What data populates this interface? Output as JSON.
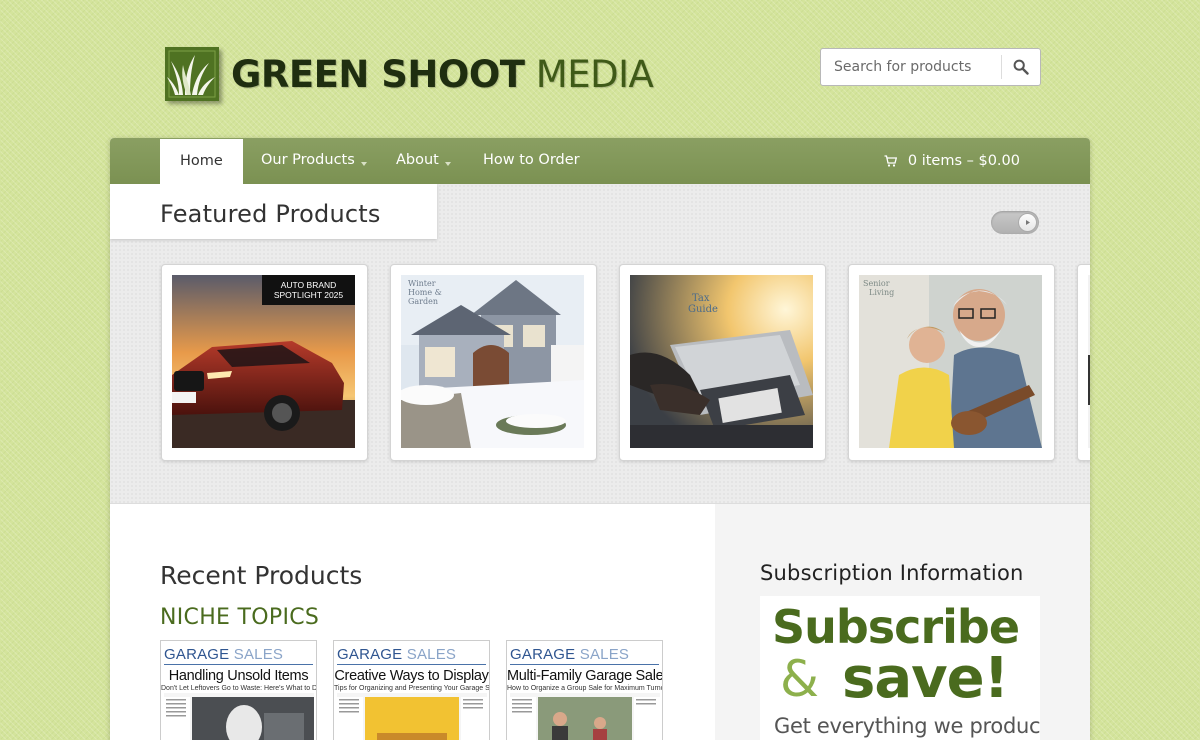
{
  "brand": {
    "name_bold": "GREEN SHOOT",
    "name_light": "MEDIA"
  },
  "search": {
    "placeholder": "Search for products"
  },
  "nav": {
    "items": [
      {
        "label": "Home",
        "active": true,
        "has_dropdown": false
      },
      {
        "label": "Our Products",
        "active": false,
        "has_dropdown": true
      },
      {
        "label": "About",
        "active": false,
        "has_dropdown": true
      },
      {
        "label": "How to Order",
        "active": false,
        "has_dropdown": false
      }
    ],
    "cart_label": "0 items – $0.00"
  },
  "featured": {
    "title": "Featured Products",
    "cards": [
      {
        "name": "auto-brand-spotlight",
        "overlay": "AUTO BRAND\nSPOTLIGHT 2025",
        "overlay_line1": "AUTO BRAND",
        "overlay_line2": "SPOTLIGHT 2025"
      },
      {
        "name": "winter-home-garden",
        "overlay_line1": "Winter",
        "overlay_line2": "Home &",
        "overlay_line3": "Garden"
      },
      {
        "name": "tax-guide",
        "overlay_line1": "Tax",
        "overlay_line2": "Guide"
      },
      {
        "name": "senior-living",
        "overlay_line1": "Senior",
        "overlay_line2": "Living"
      }
    ]
  },
  "recent": {
    "title": "Recent Products",
    "category": "NICHE TOPICS",
    "products": [
      {
        "series_a": "GARAGE",
        "series_b": "SALES",
        "title": "Handling Unsold Items",
        "subtitle": "Don't Let Leftovers Go to Waste: Here's What to Do Instead"
      },
      {
        "series_a": "GARAGE",
        "series_b": "SALES",
        "title": "Creative Ways to Display",
        "subtitle": "Tips for Organizing and Presenting Your Garage Sale Like a Pro"
      },
      {
        "series_a": "GARAGE",
        "series_b": "SALES",
        "title": "Multi-Family Garage Sales",
        "subtitle": "How to Organize a Group Sale for Maximum Turnout and Profit"
      }
    ]
  },
  "subscription": {
    "title": "Subscription Information",
    "line1": "Subscribe",
    "amp": "&",
    "line2": "save!",
    "line3": "Get everything we produce"
  },
  "colors": {
    "background": "#d4e49c",
    "nav": "#7b9152",
    "brand_green": "#4a6b1e",
    "accent_green": "#8db04c",
    "series_blue": "#4a72a8"
  }
}
